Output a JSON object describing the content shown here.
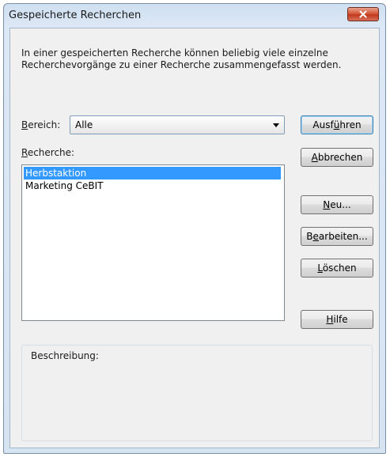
{
  "window": {
    "title": "Gespeicherte Recherchen"
  },
  "intro_text": "In einer gespeicherten Recherche können beliebig viele einzelne Recherchevorgänge zu einer Recherche zusammengefasst werden.",
  "bereich": {
    "label_accesskey": "B",
    "label_rest": "ereich:",
    "value": "Alle"
  },
  "recherche": {
    "label_accesskey": "R",
    "label_rest": "echerche:",
    "items": [
      {
        "label": "Herbstaktion",
        "selected": true
      },
      {
        "label": "Marketing CeBIT",
        "selected": false
      }
    ]
  },
  "buttons": {
    "ausfuehren": {
      "pre": "Ausf",
      "key": "ü",
      "post": "hren"
    },
    "abbrechen": {
      "pre": "",
      "key": "A",
      "post": "bbrechen"
    },
    "neu": {
      "pre": "",
      "key": "N",
      "post": "eu..."
    },
    "bearbeiten": {
      "pre": "B",
      "key": "e",
      "post": "arbeiten..."
    },
    "loeschen": {
      "pre": "",
      "key": "L",
      "post": "öschen"
    },
    "hilfe": {
      "pre": "",
      "key": "H",
      "post": "ilfe"
    }
  },
  "beschreibung": {
    "label": "Beschreibung:"
  },
  "colors": {
    "selection": "#3399ff",
    "close_button": "#c13a1d"
  }
}
